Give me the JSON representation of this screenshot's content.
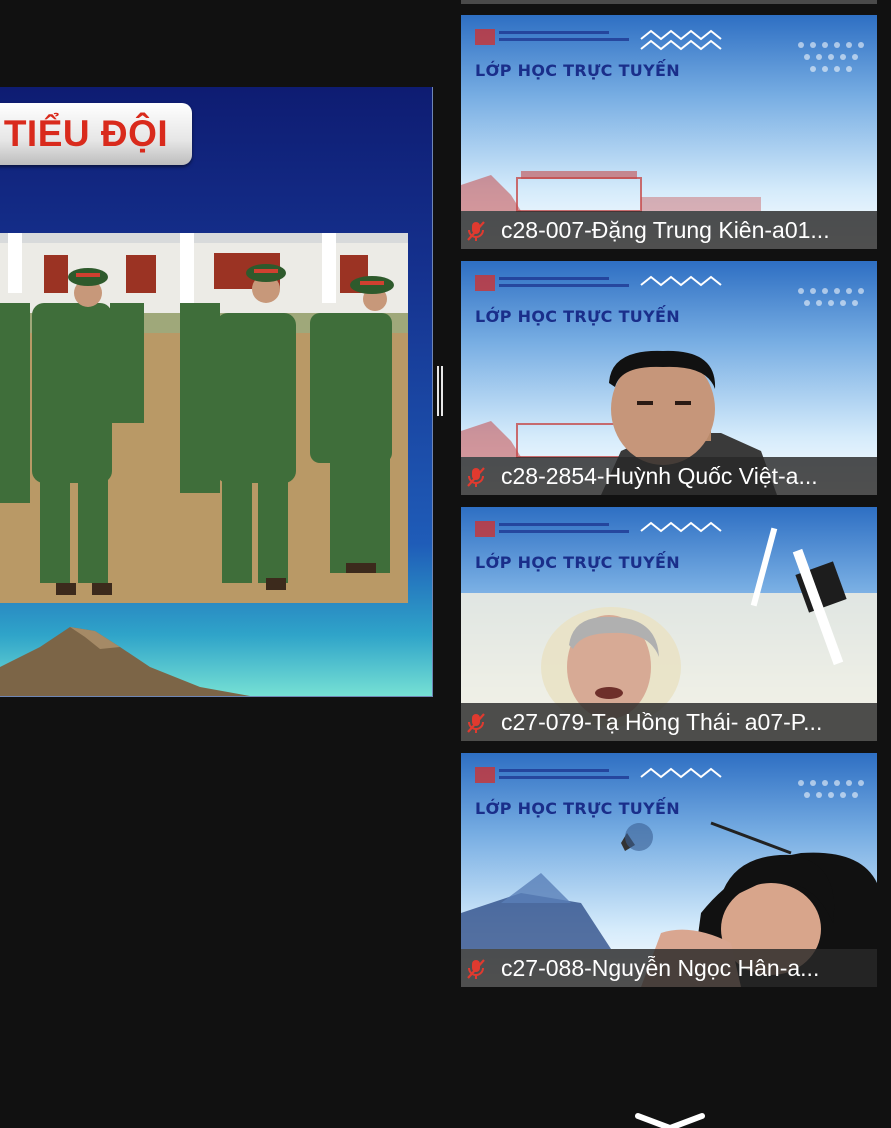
{
  "slide": {
    "title": "TIỂU ĐỘI",
    "photo_description_icon": "soldiers-photo"
  },
  "banner_text": "LỚP HỌC TRỰC TUYẾN",
  "participants": [
    {
      "name": "c28-007-Đặng Trung Kiên-a01..."
    },
    {
      "name": "c28-2854-Huỳnh Quốc Việt-a..."
    },
    {
      "name": "c27-079-Tạ Hồng Thái- a07-P..."
    },
    {
      "name": "c27-088-Nguyễn Ngọc Hân-a..."
    }
  ],
  "icons": {
    "mic": "muted-mic-icon",
    "divider": "resize-handle-icon",
    "scroll": "chevron-down-icon"
  },
  "colors": {
    "background": "#111111",
    "slide_title": "#d92a1c",
    "mute_red": "#e03a2f"
  }
}
